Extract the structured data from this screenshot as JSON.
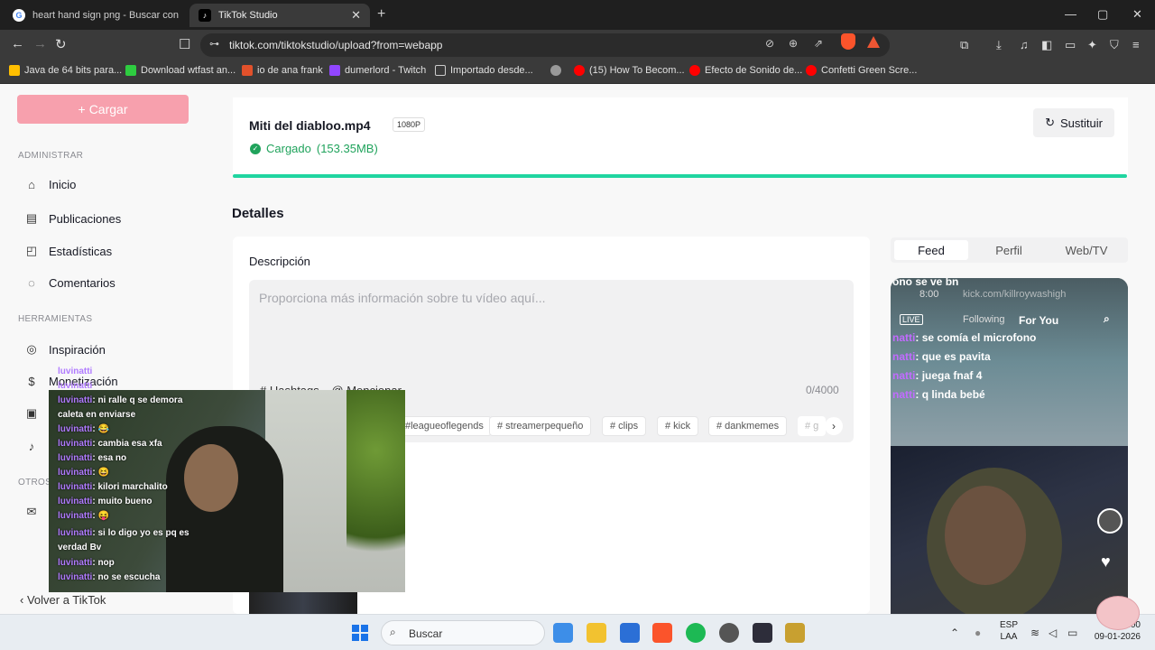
{
  "browser": {
    "tabs": [
      {
        "title": "heart hand sign png - Buscar con Go",
        "favicon": "G",
        "active": false
      },
      {
        "title": "TikTok Studio",
        "favicon": "♪",
        "active": true
      }
    ],
    "url": "tiktok.com/tiktokstudio/upload?from=webapp",
    "bookmarks": [
      {
        "label": "Java de 64 bits para...",
        "icon_color": "#ffbf00"
      },
      {
        "label": "Download wtfast an...",
        "icon_color": "#2ecc40"
      },
      {
        "label": "io de ana frank",
        "icon_color": "#e2512b"
      },
      {
        "label": "dumerlord - Twitch",
        "icon_color": "#9146ff"
      },
      {
        "label": "Importado desde...",
        "icon_color": "#cccccc"
      },
      {
        "label": "(15) How To Becom...",
        "icon_color": "#ff0000"
      },
      {
        "label": "Efecto de Sonido de...",
        "icon_color": "#ff0000"
      },
      {
        "label": "Confetti Green Scre...",
        "icon_color": "#ff0000"
      }
    ]
  },
  "sidebar": {
    "upload_label": "Cargar",
    "sections": {
      "manage": "ADMINISTRAR",
      "tools": "HERRAMIENTAS",
      "others": "OTROS"
    },
    "items": [
      {
        "label": "Inicio",
        "icon": "home-icon"
      },
      {
        "label": "Publicaciones",
        "icon": "posts-icon"
      },
      {
        "label": "Estadísticas",
        "icon": "analytics-icon"
      },
      {
        "label": "Comentarios",
        "icon": "comments-icon"
      },
      {
        "label": "Inspiración",
        "icon": "bulb-icon"
      },
      {
        "label": "Monetización",
        "icon": "dollar-icon"
      }
    ],
    "back_label": "Volver a TikTok"
  },
  "upload": {
    "file_name": "Miti del diabloo.mp4",
    "resolution": "1080P",
    "status": "Cargado",
    "size": "(153.35MB)",
    "replace_label": "Sustituir",
    "progress": 1.0,
    "accent": "#20d5a0"
  },
  "details": {
    "heading": "Detalles",
    "description_label": "Descripción",
    "description_placeholder": "Proporciona más información sobre tu vídeo aquí...",
    "hashtags_label": "# Hashtags",
    "mention_label": "@ Mencionar",
    "counter": "0/4000",
    "suggested_tags": [
      "#leagueoflegends",
      "# streamerpequeño",
      "# clips",
      "# kick",
      "# dankmemes",
      "# g"
    ]
  },
  "preview": {
    "tabs": [
      "Feed",
      "Perfil",
      "Web/TV"
    ],
    "active_tab": "Feed",
    "top_text": "ono se ve bn",
    "time": "8:00",
    "kick_text": "kick.com/killroywashigh",
    "live_label": "LIVE",
    "following": "Following",
    "for_you": "For You",
    "chat": [
      {
        "user": "natti",
        "msg": "se comía el microfono"
      },
      {
        "user": "natti",
        "msg": "que es pavita"
      },
      {
        "user": "natti",
        "msg": "juega fnaf 4"
      },
      {
        "user": "natti",
        "msg": "q linda bebé"
      }
    ]
  },
  "overlay": {
    "chat": [
      {
        "user": "luvinatti",
        "msg": "ni ralle q se demora"
      },
      {
        "user": "",
        "msg": "caleta en enviarse"
      },
      {
        "user": "luvinatti",
        "msg": "😂"
      },
      {
        "user": "luvinatti",
        "msg": "cambia esa xfa"
      },
      {
        "user": "luvinatti",
        "msg": "esa no"
      },
      {
        "user": "luvinatti",
        "msg": "😆"
      },
      {
        "user": "luvinatti",
        "msg": "kilori marchalito"
      },
      {
        "user": "luvinatti",
        "msg": "muito bueno"
      },
      {
        "user": "luvinatti",
        "msg": "😝"
      },
      {
        "user": "luvinatti",
        "msg": "si lo digo yo es pq es"
      },
      {
        "user": "",
        "msg": "verdad Bv"
      },
      {
        "user": "luvinatti",
        "msg": "nop"
      },
      {
        "user": "luvinatti",
        "msg": "no se escucha"
      }
    ],
    "leak_labels": [
      "luvinatti",
      "luvinatti"
    ]
  },
  "taskbar": {
    "search_label": "Buscar",
    "lang_top": "ESP",
    "lang_bottom": "LAA",
    "time": "0:00",
    "date": "09-01-2026"
  }
}
